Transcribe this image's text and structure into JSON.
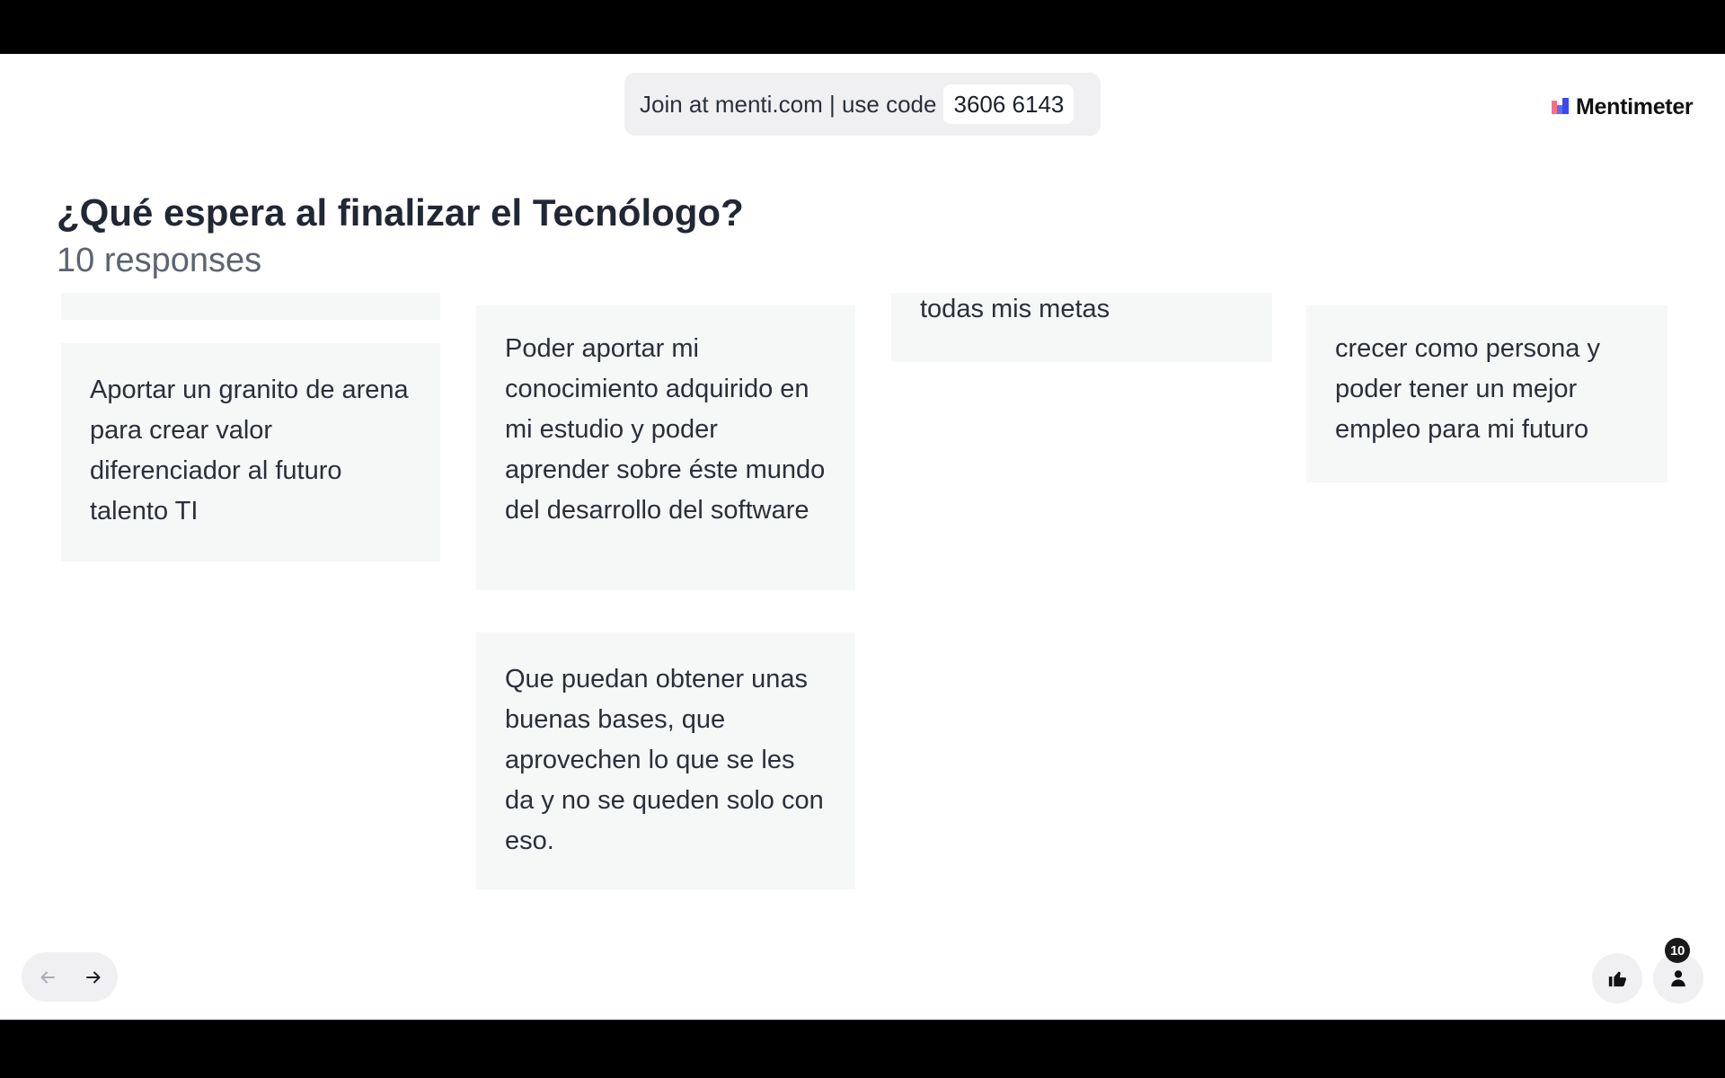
{
  "header": {
    "join_text": "Join at menti.com | use code",
    "code": "3606 6143",
    "brand": "Mentimeter"
  },
  "question": {
    "title": "¿Qué espera al finalizar el Tecnólogo?",
    "responses_label": "10 responses"
  },
  "responses": [
    {
      "text": ""
    },
    {
      "text": "Aportar un granito de arena para crear valor diferenciador al futuro talento TI"
    },
    {
      "text": "Poder aportar mi conocimiento adquirido en mi estudio y poder aprender sobre éste mundo del desarrollo del software"
    },
    {
      "text": "Que puedan obtener unas buenas bases, que aprovechen lo que se les da y no se queden solo con eso."
    },
    {
      "text": "todas mis metas"
    },
    {
      "text": "crecer como persona y poder tener un mejor empleo para mi futuro"
    }
  ],
  "controls": {
    "participant_count": "10",
    "icons": {
      "prev": "arrow-left-icon",
      "next": "arrow-right-icon",
      "reactions": "thumbs-up-icon",
      "participants": "person-icon"
    }
  },
  "colors": {
    "card_bg": "#f6f7f7",
    "pill_bg": "#f0f0f2",
    "title": "#212734",
    "subtitle": "#5d6470",
    "frame": "#000000"
  }
}
